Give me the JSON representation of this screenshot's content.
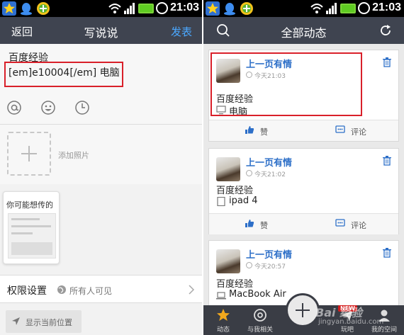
{
  "status_bar": {
    "time": "21:03"
  },
  "compose": {
    "back_label": "返回",
    "title": "写说说",
    "publish_label": "发表",
    "text_line1": "百度经验",
    "text_line2": "[em]e10004[/em] 电脑",
    "add_photo_label": "添加照片",
    "suggest_title": "你可能想传的",
    "permission_label": "权限设置",
    "permission_value": "所有人可见",
    "location_label": "显示当前位置"
  },
  "feed": {
    "title": "全部动态",
    "like_label": "赞",
    "comment_label": "评论",
    "posts": [
      {
        "author": "上一页有情",
        "time": "今天21:03",
        "text": "百度经验",
        "device": "电脑"
      },
      {
        "author": "上一页有情",
        "time": "今天21:02",
        "text": "百度经验",
        "device": "ipad 4"
      },
      {
        "author": "上一页有情",
        "time": "今天20:57",
        "text": "百度经验",
        "device": "MacBook Air"
      }
    ],
    "tabs": [
      {
        "label": "动态",
        "icon": "star-icon"
      },
      {
        "label": "与我相关",
        "icon": "at-icon"
      },
      {
        "label": "玩吧",
        "icon": "plane-icon"
      },
      {
        "label": "我的空间",
        "icon": "person-icon"
      }
    ],
    "new_badge": "NEW",
    "watermark_line1": "Bai 经验",
    "watermark_line2": "jingyan.baidu.com"
  },
  "colors": {
    "accent_blue": "#2d6fc8",
    "highlight_red": "#d9202a",
    "titlebar": "#3f4450"
  }
}
